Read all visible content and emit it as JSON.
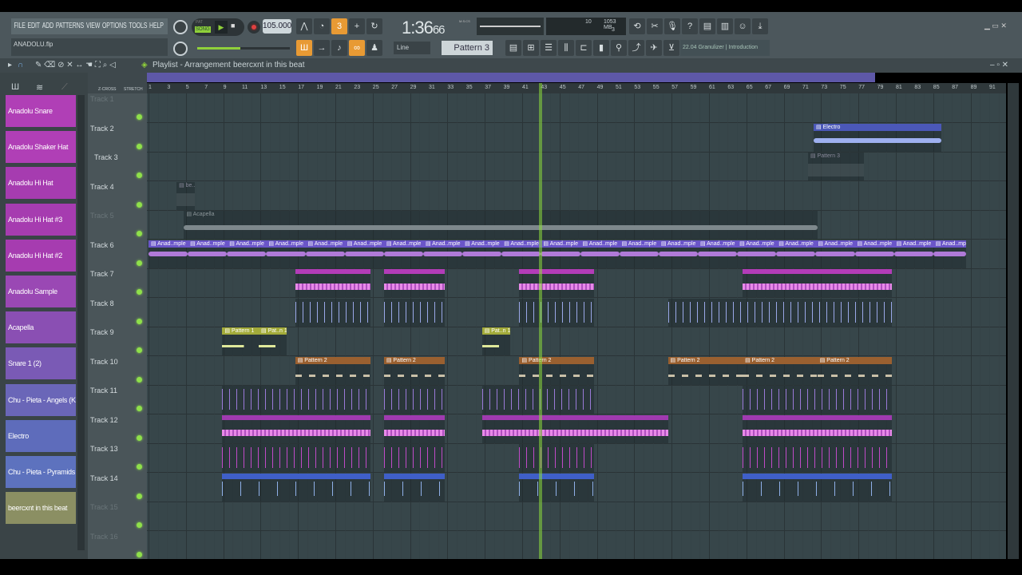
{
  "menu": [
    "FILE",
    "EDIT",
    "ADD",
    "PATTERNS",
    "VIEW",
    "OPTIONS",
    "TOOLS",
    "HELP"
  ],
  "project_file": "ANADOLU.flp",
  "transport": {
    "mode_pat": "PAT",
    "mode_song": "SONG",
    "tempo": "105.000",
    "time": "1:36",
    "time_sub": "66",
    "time_unit": "M:S:CS"
  },
  "perf": {
    "cpu": "10",
    "mem": "1053 MB",
    "poly": "3"
  },
  "snap": "Line",
  "pattern_selector": "Pattern 3",
  "news": "22.04  Granulizer | Introduction",
  "playlist": {
    "title": "Playlist - Arrangement",
    "crumb": "beercxnt in this beat",
    "zcross": "Z-CROSS",
    "stretch": "STRETCH"
  },
  "channels": [
    {
      "name": "Anadolu Snare",
      "color": "#b03fb6"
    },
    {
      "name": "Anadolu Shaker Hat",
      "color": "#b03fb6"
    },
    {
      "name": "Anadolu Hi Hat",
      "color": "#a63cb0"
    },
    {
      "name": "Anadolu Hi Hat #3",
      "color": "#a63cb0"
    },
    {
      "name": "Anadolu Hi Hat #2",
      "color": "#a63cb0"
    },
    {
      "name": "Anadolu Sample",
      "color": "#9a48b4"
    },
    {
      "name": "Acapella",
      "color": "#8a4fb3"
    },
    {
      "name": "Snare 1 (2)",
      "color": "#7a5ab5"
    },
    {
      "name": "Chu - Pieta - Angels (Kick)",
      "color": "#6a66b8"
    },
    {
      "name": "Electro",
      "color": "#5e6cbb"
    },
    {
      "name": "Chu - Pieta - Pyramids (...",
      "color": "#5d72be"
    },
    {
      "name": "beercxnt in this beat",
      "color": "#8b8f63"
    }
  ],
  "tracks": [
    "Track 1",
    "Track 2",
    "Track 3",
    "Track 4",
    "Track 5",
    "Track 6",
    "Track 7",
    "Track 8",
    "Track 9",
    "Track 10",
    "Track 11",
    "Track 12",
    "Track 13",
    "Track 14",
    "Track 15",
    "Track 16"
  ],
  "ruler": {
    "first_bar": 1,
    "last_bar": 91,
    "step": 2
  },
  "playhead_bar": 43,
  "clips": [
    {
      "track": 2,
      "start": 72.2,
      "end": 85.9,
      "label": "Electro",
      "color": "#4b58b8",
      "kind": "audio"
    },
    {
      "track": 3,
      "start": 71.6,
      "end": 77.6,
      "label": "Pattern 3",
      "color": "#3e4a4e",
      "kind": "faint"
    },
    {
      "track": 4,
      "start": 4,
      "end": 6,
      "label": "be..1",
      "color": "#6b7478",
      "kind": "faint"
    },
    {
      "track": 5,
      "start": 4.8,
      "end": 72.6,
      "label": "Acapella",
      "color": "#4f5b5f",
      "kind": "audio-muted"
    },
    {
      "track": 6,
      "start": 1,
      "end": 88.5,
      "label": "Anad..mple",
      "color": "#6a55c8",
      "kind": "repeat",
      "every": 4.2
    },
    {
      "track": 7,
      "start": 16.7,
      "end": 24.8,
      "label": "",
      "color": "#b33cb8",
      "kind": "pink"
    },
    {
      "track": 7,
      "start": 26.2,
      "end": 32.7,
      "label": "",
      "color": "#b33cb8",
      "kind": "pink"
    },
    {
      "track": 7,
      "start": 40.7,
      "end": 48.7,
      "label": "",
      "color": "#b33cb8",
      "kind": "pink"
    },
    {
      "track": 7,
      "start": 64.6,
      "end": 80.6,
      "label": "",
      "color": "#b33cb8",
      "kind": "pink"
    },
    {
      "track": 8,
      "start": 16.7,
      "end": 24.8,
      "label": "",
      "color": "#9aa8e8",
      "kind": "ticks"
    },
    {
      "track": 8,
      "start": 26.2,
      "end": 32.7,
      "label": "",
      "color": "#9aa8e8",
      "kind": "ticks"
    },
    {
      "track": 8,
      "start": 40.7,
      "end": 48.7,
      "label": "",
      "color": "#9aa8e8",
      "kind": "ticks"
    },
    {
      "track": 8,
      "start": 56.6,
      "end": 80.6,
      "label": "",
      "color": "#9aa8e8",
      "kind": "ticks"
    },
    {
      "track": 9,
      "start": 8.9,
      "end": 12.8,
      "label": "Pattern 1",
      "color": "#a3ab3a",
      "kind": "pattern"
    },
    {
      "track": 9,
      "start": 12.8,
      "end": 15.8,
      "label": "Pat..n 1",
      "color": "#a3ab3a",
      "kind": "pattern"
    },
    {
      "track": 9,
      "start": 36.7,
      "end": 39.7,
      "label": "Pat..n 1",
      "color": "#a3ab3a",
      "kind": "pattern"
    },
    {
      "track": 10,
      "start": 16.7,
      "end": 24.8,
      "label": "Pattern 2",
      "color": "#9a6030",
      "kind": "pattern"
    },
    {
      "track": 10,
      "start": 26.2,
      "end": 32.7,
      "label": "Pattern 2",
      "color": "#9a6030",
      "kind": "pattern"
    },
    {
      "track": 10,
      "start": 40.7,
      "end": 48.7,
      "label": "Pattern 2",
      "color": "#9a6030",
      "kind": "pattern"
    },
    {
      "track": 10,
      "start": 56.6,
      "end": 64.6,
      "label": "Pattern 2",
      "color": "#9a6030",
      "kind": "pattern"
    },
    {
      "track": 10,
      "start": 64.6,
      "end": 72.6,
      "label": "Pattern 2",
      "color": "#9a6030",
      "kind": "pattern"
    },
    {
      "track": 10,
      "start": 72.6,
      "end": 80.6,
      "label": "Pattern 2",
      "color": "#9a6030",
      "kind": "pattern"
    },
    {
      "track": 11,
      "start": 8.9,
      "end": 24.8,
      "label": "",
      "color": "#9a7ad8",
      "kind": "ticks"
    },
    {
      "track": 11,
      "start": 26.2,
      "end": 32.7,
      "label": "",
      "color": "#9a7ad8",
      "kind": "ticks"
    },
    {
      "track": 11,
      "start": 36.7,
      "end": 48.7,
      "label": "",
      "color": "#9a7ad8",
      "kind": "ticks"
    },
    {
      "track": 11,
      "start": 64.6,
      "end": 80.6,
      "label": "",
      "color": "#9a7ad8",
      "kind": "ticks"
    },
    {
      "track": 12,
      "start": 8.9,
      "end": 24.8,
      "label": "",
      "color": "#a03ab0",
      "kind": "pink"
    },
    {
      "track": 12,
      "start": 26.2,
      "end": 32.7,
      "label": "",
      "color": "#a03ab0",
      "kind": "pink"
    },
    {
      "track": 12,
      "start": 36.7,
      "end": 56.6,
      "label": "",
      "color": "#a03ab0",
      "kind": "pink"
    },
    {
      "track": 12,
      "start": 64.6,
      "end": 80.6,
      "label": "",
      "color": "#a03ab0",
      "kind": "pink"
    },
    {
      "track": 13,
      "start": 8.9,
      "end": 24.8,
      "label": "",
      "color": "#c04ac8",
      "kind": "ticks"
    },
    {
      "track": 13,
      "start": 26.2,
      "end": 32.7,
      "label": "",
      "color": "#c04ac8",
      "kind": "ticks"
    },
    {
      "track": 13,
      "start": 40.7,
      "end": 48.7,
      "label": "",
      "color": "#c04ac8",
      "kind": "ticks"
    },
    {
      "track": 13,
      "start": 64.6,
      "end": 80.6,
      "label": "",
      "color": "#c04ac8",
      "kind": "ticks"
    },
    {
      "track": 14,
      "start": 8.9,
      "end": 24.8,
      "label": "",
      "color": "#3f5fc8",
      "kind": "blue"
    },
    {
      "track": 14,
      "start": 26.2,
      "end": 32.7,
      "label": "",
      "color": "#3f5fc8",
      "kind": "blue"
    },
    {
      "track": 14,
      "start": 40.7,
      "end": 48.7,
      "label": "",
      "color": "#3f5fc8",
      "kind": "blue"
    },
    {
      "track": 14,
      "start": 64.6,
      "end": 80.6,
      "label": "",
      "color": "#3f5fc8",
      "kind": "blue"
    }
  ]
}
